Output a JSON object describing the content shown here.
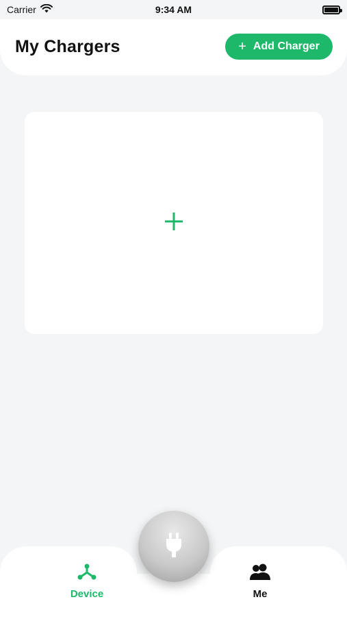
{
  "status_bar": {
    "carrier": "Carrier",
    "time": "9:34 AM"
  },
  "header": {
    "title": "My Chargers",
    "add_button_label": "Add Charger"
  },
  "bottom_nav": {
    "tabs": [
      {
        "label": "Device",
        "active": true
      },
      {
        "label": "Me",
        "active": false
      }
    ]
  },
  "colors": {
    "accent": "#1db86a",
    "background": "#f3f5f6",
    "card": "#ffffff"
  },
  "icons": {
    "wifi": "wifi-icon",
    "battery": "battery-icon",
    "add": "plus-icon",
    "device": "device-network-icon",
    "me": "people-icon",
    "center": "plug-icon"
  }
}
